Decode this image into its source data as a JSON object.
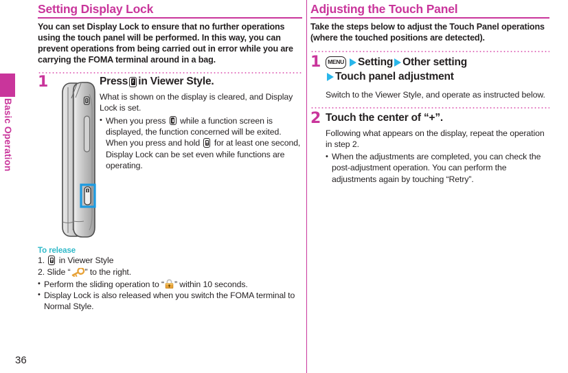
{
  "sidebar": {
    "label": "Basic Operation",
    "color": "#c9359b"
  },
  "page_number": "36",
  "left_column": {
    "title": "Setting Display Lock",
    "intro": "You can set Display Lock to ensure that no further operations using the touch panel will be performed. In this way, you can prevent operations from being carried out in error while you are carrying the FOMA terminal around in a bag.",
    "step": {
      "number": "1",
      "head_pre": "Press",
      "head_post": "in Viewer Style.",
      "desc": "What is shown on the display is cleared, and Display Lock is set.",
      "bullets": [
        {
          "part1": "When you press",
          "part2": "while a function screen is displayed, the function concerned will be exited. When you press and hold",
          "part3": "for at least one second, Display Lock can be set even while functions are operating."
        }
      ]
    },
    "release": {
      "heading": "To release",
      "item1_pre": "1.",
      "item1_post": "in Viewer Style",
      "item2_pre": "2. Slide “",
      "item2_post": "” to the right.",
      "bullets": [
        {
          "pre": "Perform the sliding operation to “",
          "post": "” within 10 seconds."
        },
        {
          "text": "Display Lock is also released when you switch the FOMA terminal to Normal Style."
        }
      ]
    }
  },
  "right_column": {
    "title": "Adjusting the Touch Panel",
    "intro": "Take the steps below to adjust the Touch Panel operations (where the touched positions are detected).",
    "steps": [
      {
        "number": "1",
        "menu_key": "MENU",
        "crumb1": "Setting",
        "crumb2": "Other setting",
        "crumb3": "Touch panel adjustment",
        "desc": "Switch to the Viewer Style, and operate as instructed below."
      },
      {
        "number": "2",
        "head": "Touch the center of “+”.",
        "desc": "Following what appears on the display, repeat the operation in step 2.",
        "bullets": [
          "When the adjustments are completed, you can check the post-adjustment operation. You can perform the adjustments again by touching “Retry”."
        ]
      }
    ]
  },
  "icons": {
    "key_button": "display-lock-key-icon",
    "menu_button": "menu-key-icon",
    "arrow": "cyan-arrow-icon",
    "gold_key": "gold-key-icon",
    "padlock": "gold-padlock-icon",
    "phone": "phone-side-view-illustration"
  },
  "colors": {
    "accent": "#c9359b",
    "sub_accent": "#2fb9c9",
    "arrow": "#29b6ea",
    "highlight_box": "#1c9ae0"
  }
}
